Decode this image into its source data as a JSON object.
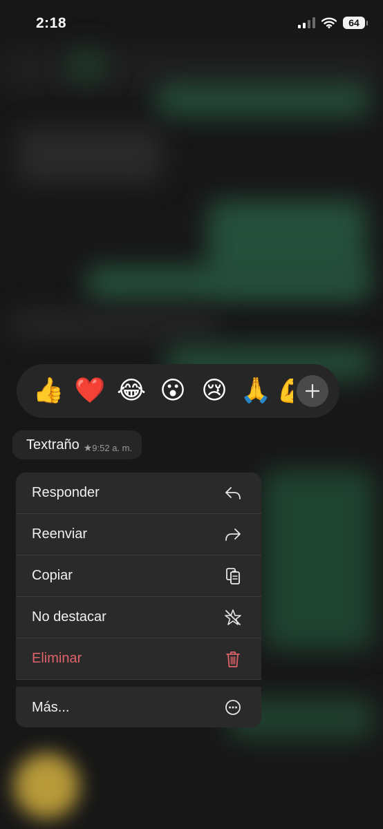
{
  "status_bar": {
    "time": "2:18",
    "battery": "64"
  },
  "reactions": {
    "emojis": [
      "👍",
      "❤️",
      "😂",
      "😮",
      "😢",
      "🙏",
      "💪"
    ],
    "more_icon": "plus-icon"
  },
  "message": {
    "text": "Textraño",
    "star": "★",
    "time": "9:52 a. m."
  },
  "menu": {
    "items": [
      {
        "label": "Responder",
        "icon": "reply-icon"
      },
      {
        "label": "Reenviar",
        "icon": "forward-icon"
      },
      {
        "label": "Copiar",
        "icon": "copy-icon"
      },
      {
        "label": "No destacar",
        "icon": "unstar-icon"
      },
      {
        "label": "Eliminar",
        "icon": "trash-icon",
        "color": "#e0636a"
      }
    ],
    "more": {
      "label": "Más...",
      "icon": "more-icon"
    }
  },
  "colors": {
    "danger": "#e0636a",
    "menu_bg": "#2a2a2a"
  }
}
